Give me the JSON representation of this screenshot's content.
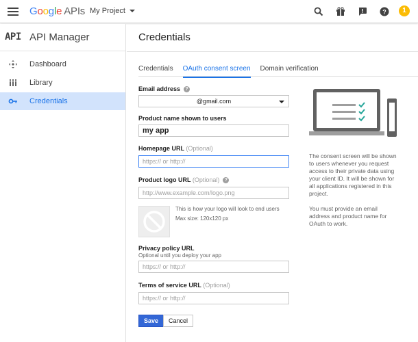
{
  "topbar": {
    "brand": {
      "g1": "G",
      "g2": "o",
      "g3": "o",
      "g4": "g",
      "g5": "l",
      "g6": "e",
      "apis": "APIs"
    },
    "project": "My Project",
    "avatar_initial": "1",
    "icons": [
      "search-icon",
      "gift-icon",
      "notifications-icon",
      "help-icon"
    ]
  },
  "sidebar": {
    "mark": "API",
    "title": "API Manager",
    "items": [
      {
        "label": "Dashboard",
        "icon": "dashboard-icon",
        "active": false
      },
      {
        "label": "Library",
        "icon": "library-icon",
        "active": false
      },
      {
        "label": "Credentials",
        "icon": "key-icon",
        "active": true
      }
    ]
  },
  "main": {
    "title": "Credentials",
    "tabs": [
      {
        "label": "Credentials",
        "active": false
      },
      {
        "label": "OAuth consent screen",
        "active": true
      },
      {
        "label": "Domain verification",
        "active": false
      }
    ],
    "form": {
      "email_label": "Email address",
      "email_value": "@gmail.com",
      "product_label": "Product name shown to users",
      "product_value": "my app",
      "homepage_label": "Homepage URL",
      "homepage_opt": "(Optional)",
      "homepage_placeholder": "https:// or http://",
      "logo_label": "Product logo URL",
      "logo_opt": "(Optional)",
      "logo_placeholder": "http://www.example.com/logo.png",
      "logo_hint_1": "This is how your logo will look to end users",
      "logo_hint_2": "Max size: 120x120 px",
      "privacy_label": "Privacy policy URL",
      "privacy_sub": "Optional until you deploy your app",
      "privacy_placeholder": "https:// or http://",
      "tos_label": "Terms of service URL",
      "tos_opt": "(Optional)",
      "tos_placeholder": "https:// or http://",
      "save_label": "Save",
      "cancel_label": "Cancel"
    },
    "info": {
      "p1": "The consent screen will be shown to users whenever you request access to their private data using your client ID. It will be shown for all applications registered in this project.",
      "p2": "You must provide an email address and product name for OAuth to work."
    }
  },
  "colors": {
    "accent": "#1a73e8",
    "save_button": "#3367d6",
    "active_nav_bg": "#d2e3fc",
    "check": "#26a69a"
  }
}
